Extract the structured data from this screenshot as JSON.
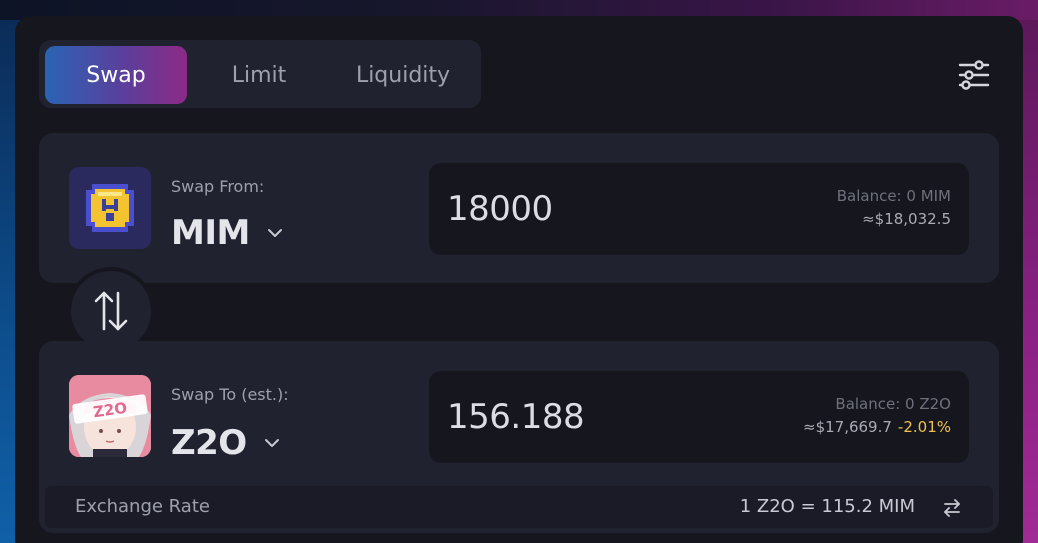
{
  "tabs": [
    {
      "label": "Swap",
      "active": true
    },
    {
      "label": "Limit",
      "active": false
    },
    {
      "label": "Liquidity",
      "active": false
    }
  ],
  "settings_icon": "sliders-icon",
  "swap_from": {
    "label": "Swap From:",
    "token": "MIM",
    "icon": "mim-token-icon",
    "amount": "18000",
    "balance": "Balance: 0 MIM",
    "usd_value": "≈$18,032.5"
  },
  "flip_icon": "swap-vertical-arrows-icon",
  "swap_to": {
    "label": "Swap To (est.):",
    "token": "Z2O",
    "icon": "z2o-token-icon",
    "icon_text": "Z2O",
    "amount": "156.188",
    "balance": "Balance: 0 Z2O",
    "usd_value": "≈$17,669.7",
    "price_impact": "-2.01%"
  },
  "exchange_rate": {
    "label": "Exchange Rate",
    "value": "1 Z2O = 115.2 MIM",
    "icon": "swap-horizontal-arrows-icon"
  },
  "colors": {
    "accent_start": "#2a64b4",
    "accent_end": "#8c2a86",
    "warning": "#f0c14b"
  }
}
